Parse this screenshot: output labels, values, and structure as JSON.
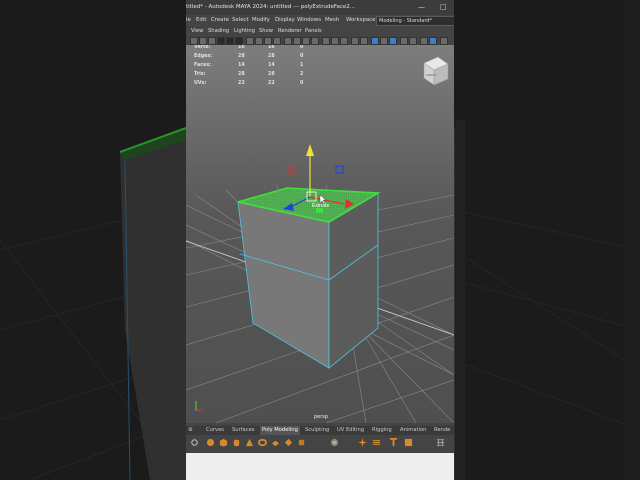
{
  "window": {
    "title": "titled* - Autodesk MAYA 2024: untitled   ---   polyExtrudeFace2...",
    "minimize_icon": "minimize-icon",
    "maximize_icon": "maximize-icon"
  },
  "menubar": {
    "items": [
      "le",
      "Edit",
      "Create",
      "Select",
      "Modify",
      "Display",
      "Windows",
      "Mesh",
      "Workspace:"
    ],
    "workspace_value": "Modeling - Standard*"
  },
  "panel_menu": [
    "View",
    "Shading",
    "Lighting",
    "Show",
    "Renderer",
    "Panels"
  ],
  "hud": {
    "rows": [
      {
        "label": "Verts:",
        "a": "16",
        "b": "16",
        "c": "0"
      },
      {
        "label": "Edges:",
        "a": "28",
        "b": "28",
        "c": "0"
      },
      {
        "label": "Faces:",
        "a": "14",
        "b": "14",
        "c": "1"
      },
      {
        "label": "Tris:",
        "a": "28",
        "b": "28",
        "c": "2"
      },
      {
        "label": "UVs:",
        "a": "22",
        "b": "22",
        "c": "0"
      }
    ]
  },
  "viewport": {
    "camera_label": "persp",
    "manipulator_label": "Extrude",
    "view_cube_label": "FRONT"
  },
  "shelf": {
    "tabs": [
      "Curves",
      "Surfaces",
      "Poly Modeling",
      "Sculpting",
      "UV Editing",
      "Rigging",
      "Animation",
      "Rende"
    ],
    "active_tab": "Poly Modeling"
  },
  "colors": {
    "accent_green": "#3fe03f",
    "selection_cyan": "#4fc3e8",
    "manip_yellow": "#f0e040",
    "manip_red": "#e03030",
    "manip_blue": "#2040e0",
    "shelf_orange": "#d88a2a"
  }
}
